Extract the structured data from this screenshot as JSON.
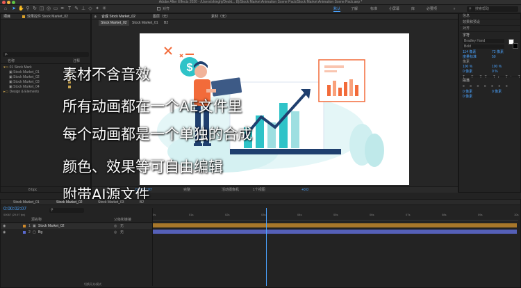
{
  "window": {
    "title": "Adobe After Effects 2020 - /Users/shinghj/Deskt... 8)/Stock Market Animation Scene Pack/Stock Market Animation Scene Pack.aep *"
  },
  "workspaces": [
    "默认",
    "了解",
    "标准",
    "小屏幕",
    "库",
    "必要项"
  ],
  "search": {
    "placeholder": "搜索帮助"
  },
  "toolbar": {
    "snap_label": "对齐"
  },
  "project_panel": {
    "tab_label": "项目",
    "effect_tab": "效果控件 Stock Market_02",
    "search_placeholder": "ρ.",
    "col_name": "名称",
    "col_comment": "注释",
    "items": [
      {
        "name": "01 Stock Mark",
        "indent": 0
      },
      {
        "name": "Stock Market_01",
        "indent": 1
      },
      {
        "name": "Stock Market_02",
        "indent": 1
      },
      {
        "name": "Stock Market_03",
        "indent": 1
      },
      {
        "name": "Stock Market_04",
        "indent": 1
      },
      {
        "name": "Design & Elements",
        "indent": 0
      }
    ],
    "bpc": "8 bpc"
  },
  "composition_panel": {
    "tab_label": "合成 Stock Market_02",
    "layer_tab": "图层（无）",
    "footage_tab": "素材（无）",
    "breadcrumbs": [
      "Stock Market_02",
      "Stock Market_01",
      "B2"
    ],
    "zoom": "(59.5%)",
    "resolution": "完整",
    "camera": "活动摄像机",
    "views": "1个视图",
    "timecode": "0;00;02;07",
    "exposure": "+0.0"
  },
  "overlay_lines": [
    "素材不含音效",
    "所有动画都在一个AE文件里",
    "每个动画都是一个单独的合成",
    "颜色、效果等可自由编辑",
    "附带AI源文件"
  ],
  "right_panel": {
    "items": [
      "信息",
      "效果和预设",
      "对齐",
      "字符",
      "段落"
    ],
    "font_name": "Bradley Hand",
    "font_style": "Bold",
    "char_values": [
      "114 像素",
      "72 像素",
      "度量标准",
      "50",
      "像素",
      "100 %",
      "100 %",
      "0 像素",
      "0 %"
    ],
    "paragraph_values": [
      "0 像素",
      "0 像素",
      "0 像素"
    ]
  },
  "timeline": {
    "tabs": [
      "Stock Market_01",
      "Stock Market_02",
      "Stock Market_03",
      "B2"
    ],
    "timecode": "0:00:02:07",
    "frame_info": "00067 (29.97 fps)",
    "col_layer_name": "源名称",
    "col_parent": "父级和链接",
    "layers": [
      {
        "index": "1",
        "name": "Stock Market_02",
        "color": "#d08a2a",
        "parent": "无"
      },
      {
        "index": "2",
        "name": "Bg",
        "color": "#5a6ad0",
        "parent": "无"
      }
    ],
    "ruler": [
      "0s",
      "01s",
      "02s",
      "03s",
      "04s",
      "05s",
      "06s",
      "07s",
      "08s",
      "09s",
      "10s"
    ],
    "footer": "切换开关/模式",
    "playhead_fraction": 0.31
  },
  "colors": {
    "accent": "#4aa3ff",
    "illus_teal": "#2fc3c8",
    "illus_navy": "#1f3f6e",
    "illus_orange": "#f26b3a",
    "layer1": "#a8772a",
    "layer2": "#5560b8"
  }
}
